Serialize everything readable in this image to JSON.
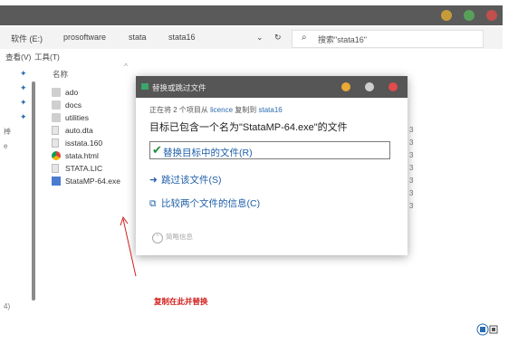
{
  "window": {
    "dots": [
      "#c89b3a",
      "#58a05a",
      "#c0504d"
    ]
  },
  "address": {
    "crumbs": [
      "软件 (E:)",
      "prosoftware",
      "stata",
      "stata16"
    ],
    "search_placeholder": "搜索\"stata16\""
  },
  "menu": {
    "view": "查看(V)",
    "tools": "工具(T)"
  },
  "columns": {
    "name": "名称"
  },
  "files": [
    {
      "name": "ado",
      "type": "folder"
    },
    {
      "name": "docs",
      "type": "folder"
    },
    {
      "name": "utilities",
      "type": "folder"
    },
    {
      "name": "auto.dta",
      "type": "doc"
    },
    {
      "name": "isstata.160",
      "type": "doc"
    },
    {
      "name": "stata.html",
      "type": "chrome"
    },
    {
      "name": "STATA.LIC",
      "type": "doc"
    },
    {
      "name": "StataMP-64.exe",
      "type": "exe"
    }
  ],
  "dialog": {
    "title": "替换或跳过文件",
    "line1_prefix": "正在将 2 个项目从 ",
    "line1_src": "licence",
    "line1_mid": " 复制到 ",
    "line1_dst": "stata16",
    "line2": "目标已包含一个名为\"StataMP-64.exe\"的文件",
    "opt_replace": "替换目标中的文件(R)",
    "opt_skip": "跳过该文件(S)",
    "opt_compare": "比较两个文件的信息(C)",
    "details": "简略信息",
    "dots": [
      "#e8a935",
      "#cfcfcf",
      "#e04b4b"
    ]
  },
  "annotation": "复制在此并替换",
  "sidebar": {
    "text1": "棒",
    "text2": "e",
    "text3": "4)"
  },
  "right_col": [
    "3",
    "3",
    "3",
    "3",
    "3",
    "3",
    "3"
  ]
}
